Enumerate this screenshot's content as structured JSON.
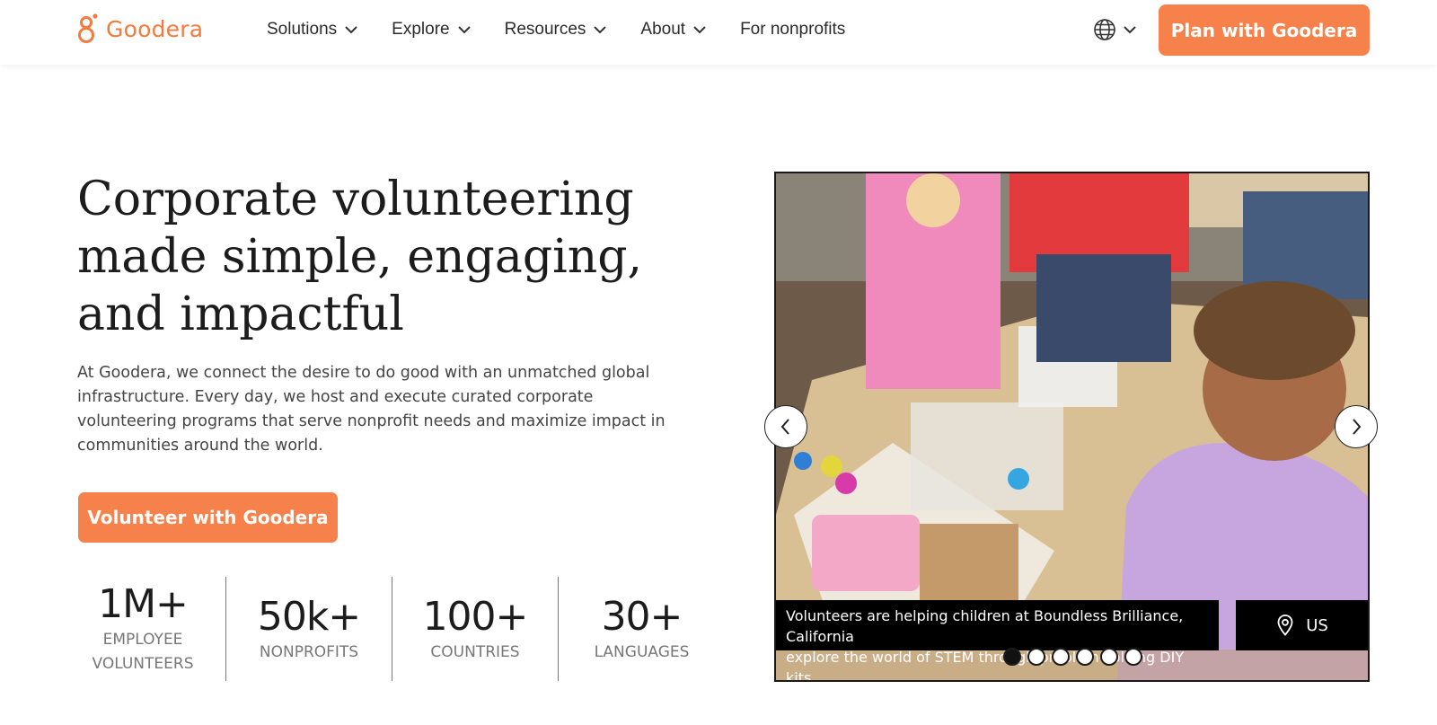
{
  "brand": {
    "name": "Goodera",
    "color": "#f47a3e"
  },
  "nav": {
    "items": [
      {
        "label": "Solutions",
        "has_dropdown": true
      },
      {
        "label": "Explore",
        "has_dropdown": true
      },
      {
        "label": "Resources",
        "has_dropdown": true
      },
      {
        "label": "About",
        "has_dropdown": true
      },
      {
        "label": "For nonprofits",
        "has_dropdown": false
      }
    ],
    "language_icon": "globe-icon",
    "cta": "Plan with Goodera"
  },
  "hero": {
    "title_lines": [
      "Corporate volunteering",
      "made simple, engaging,",
      "and impactful"
    ],
    "description": "At Goodera, we connect the desire to do good with an unmatched global infrastructure. Every day, we host and execute curated corporate volunteering programs that serve nonprofit needs and maximize impact in communities around the world.",
    "cta": "Volunteer with Goodera"
  },
  "stats": [
    {
      "value": "1M+",
      "label_lines": [
        "EMPLOYEE",
        "VOLUNTEERS"
      ]
    },
    {
      "value": "50k+",
      "label_lines": [
        "NONPROFITS"
      ]
    },
    {
      "value": "100+",
      "label_lines": [
        "COUNTRIES"
      ]
    },
    {
      "value": "30+",
      "label_lines": [
        "LANGUAGES"
      ]
    }
  ],
  "carousel": {
    "caption_lines": [
      "Volunteers are helping children at Boundless Brilliance, California",
      "explore the world of STEM through problem-solving DIY kits."
    ],
    "location": "US",
    "slide_count": 6,
    "active_slide": 1
  },
  "colors": {
    "accent": "#f6814a",
    "text": "#1c1c1c",
    "muted": "#777777"
  }
}
